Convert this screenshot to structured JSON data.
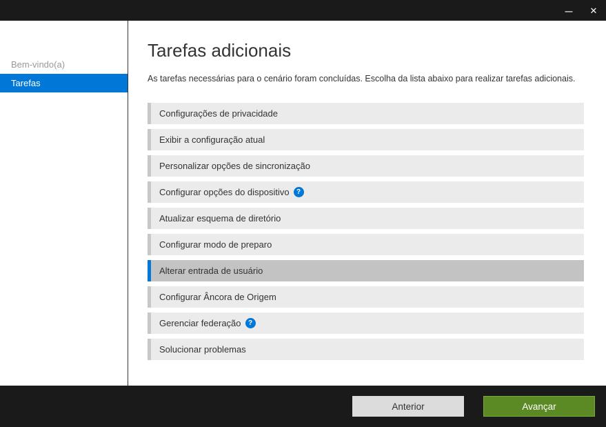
{
  "sidebar": {
    "items": [
      {
        "label": "Bem-vindo(a)",
        "active": false
      },
      {
        "label": "Tarefas",
        "active": true
      }
    ]
  },
  "main": {
    "title": "Tarefas adicionais",
    "subtitle": "As tarefas necessárias para o cenário foram concluídas. Escolha da lista abaixo para realizar tarefas adicionais.",
    "tasks": [
      {
        "label": "Configurações de privacidade",
        "selected": false,
        "help": false
      },
      {
        "label": "Exibir a configuração atual",
        "selected": false,
        "help": false
      },
      {
        "label": "Personalizar opções de sincronização",
        "selected": false,
        "help": false
      },
      {
        "label": "Configurar opções do dispositivo",
        "selected": false,
        "help": true
      },
      {
        "label": "Atualizar esquema de diretório",
        "selected": false,
        "help": false
      },
      {
        "label": "Configurar modo de preparo",
        "selected": false,
        "help": false
      },
      {
        "label": "Alterar entrada de usuário",
        "selected": true,
        "help": false
      },
      {
        "label": "Configurar Âncora de Origem",
        "selected": false,
        "help": false
      },
      {
        "label": "Gerenciar federação",
        "selected": false,
        "help": true
      },
      {
        "label": "Solucionar problemas",
        "selected": false,
        "help": false
      }
    ]
  },
  "footer": {
    "previous": "Anterior",
    "next": "Avançar"
  }
}
